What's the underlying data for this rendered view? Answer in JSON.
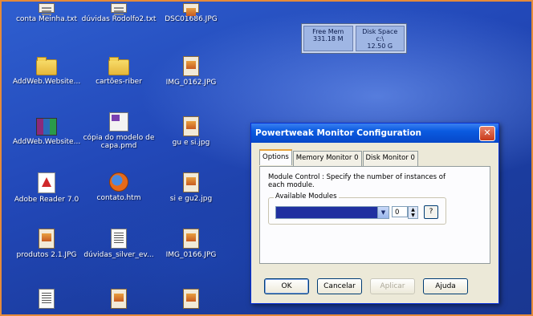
{
  "desktop": {
    "icons": [
      {
        "label": "conta Meinha.txt",
        "icon": "text-file"
      },
      {
        "label": "dúvidas Rodolfo2.txt",
        "icon": "text-file"
      },
      {
        "label": "DSC01686.JPG",
        "icon": "jpg-image"
      },
      {
        "label": "AddWeb.Website...",
        "icon": "folder"
      },
      {
        "label": "cartões-riber",
        "icon": "folder"
      },
      {
        "label": "IMG_0162.JPG",
        "icon": "jpg-image"
      },
      {
        "label": "AddWeb.Website...",
        "icon": "winrar-archive"
      },
      {
        "label": "cópia do modelo de capa.pmd",
        "icon": "pagemaker-file"
      },
      {
        "label": "gu e si.jpg",
        "icon": "jpg-image"
      },
      {
        "label": "Adobe Reader 7.0",
        "icon": "adobe-reader"
      },
      {
        "label": "contato.htm",
        "icon": "firefox-html"
      },
      {
        "label": "si e gu2.jpg",
        "icon": "jpg-image"
      },
      {
        "label": "produtos 2.1.JPG",
        "icon": "jpg-image"
      },
      {
        "label": "dúvidas_silver_ev...",
        "icon": "document"
      },
      {
        "label": "IMG_0166.JPG",
        "icon": "jpg-image"
      }
    ]
  },
  "widget": {
    "free_mem_label": "Free Mem",
    "free_mem_value": "331.18 M",
    "disk_space_label": "Disk Space",
    "disk_drive": "c:\\",
    "disk_value": "12.50 G"
  },
  "dialog": {
    "title": "Powertweak Monitor Configuration",
    "close_glyph": "✕",
    "tabs": [
      "Options",
      "Memory Monitor 0",
      "Disk Monitor 0"
    ],
    "description": "Module Control : Specify the number of instances of each module.",
    "group_label": "Available Modules",
    "module_count": "0",
    "help_label": "?",
    "buttons": {
      "ok": "OK",
      "cancel": "Cancelar",
      "apply": "Aplicar",
      "help": "Ajuda"
    }
  },
  "colors": {
    "titlebar": "#0a5ae0",
    "desktop": "#2248b8",
    "frame_accent": "#e58a3a"
  }
}
